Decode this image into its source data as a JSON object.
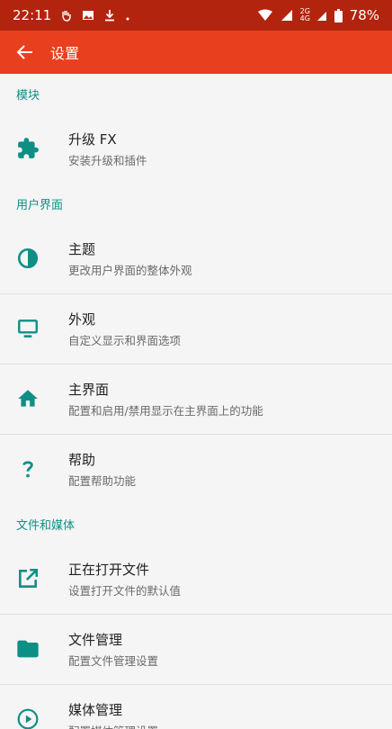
{
  "status_bar": {
    "time": "22:11",
    "net_top": "2G",
    "net_bottom": "4G",
    "battery": "78%"
  },
  "app_bar": {
    "title": "设置"
  },
  "sections": [
    {
      "header": "模块",
      "items": [
        {
          "title": "升级 FX",
          "subtitle": "安装升级和插件",
          "icon": "puzzle-icon"
        }
      ]
    },
    {
      "header": "用户界面",
      "items": [
        {
          "title": "主题",
          "subtitle": "更改用户界面的整体外观",
          "icon": "contrast-icon"
        },
        {
          "title": "外观",
          "subtitle": "自定义显示和界面选项",
          "icon": "monitor-icon"
        },
        {
          "title": "主界面",
          "subtitle": "配置和启用/禁用显示在主界面上的功能",
          "icon": "home-icon"
        },
        {
          "title": "帮助",
          "subtitle": "配置帮助功能",
          "icon": "question-icon"
        }
      ]
    },
    {
      "header": "文件和媒体",
      "items": [
        {
          "title": "正在打开文件",
          "subtitle": "设置打开文件的默认值",
          "icon": "open-external-icon"
        },
        {
          "title": "文件管理",
          "subtitle": "配置文件管理设置",
          "icon": "folder-icon"
        },
        {
          "title": "媒体管理",
          "subtitle": "配置媒体管理设置",
          "icon": "play-circle-icon"
        }
      ]
    }
  ],
  "colors": {
    "status_bar": "#b3240e",
    "app_bar": "#e8401e",
    "accent": "#0e8f86",
    "background": "#f5f5f5"
  }
}
